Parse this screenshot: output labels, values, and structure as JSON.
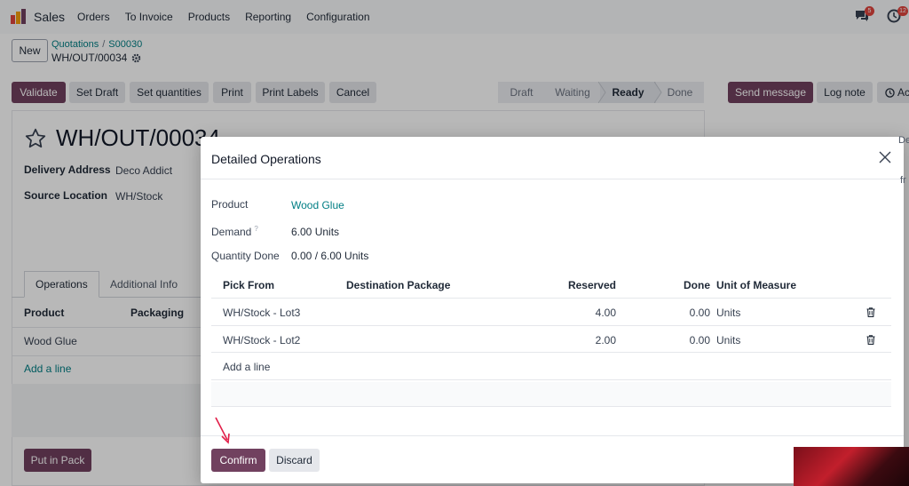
{
  "navbar": {
    "app_name": "Sales",
    "menu": [
      "Orders",
      "To Invoice",
      "Products",
      "Reporting",
      "Configuration"
    ],
    "chat_badge": "5",
    "activity_badge": "12"
  },
  "control": {
    "new_label": "New",
    "breadcrumb_parent": "Quotations",
    "breadcrumb_child": "S00030",
    "record_ref": "WH/OUT/00034"
  },
  "actions": [
    "Validate",
    "Set Draft",
    "Set quantities",
    "Print",
    "Print Labels",
    "Cancel"
  ],
  "status_stages": [
    "Draft",
    "Waiting",
    "Ready",
    "Done"
  ],
  "status_active": "Ready",
  "chatter": {
    "send_message": "Send message",
    "log_note": "Log note",
    "activities_fragment": "Ac"
  },
  "form": {
    "title": "WH/OUT/00034",
    "delivery_address_label": "Delivery Address",
    "delivery_address_value": "Deco Addict",
    "source_location_label": "Source Location",
    "source_location_value": "WH/Stock",
    "tabs": [
      "Operations",
      "Additional Info"
    ],
    "table_headers": [
      "Product",
      "Packaging"
    ],
    "row_product": "Wood Glue",
    "add_line": "Add a line",
    "put_in_pack": "Put in Pack"
  },
  "dialog": {
    "title": "Detailed Operations",
    "product_label": "Product",
    "product_value": "Wood Glue",
    "demand_label": "Demand",
    "demand_help": "?",
    "demand_value": "6.00 Units",
    "qty_done_label": "Quantity Done",
    "qty_done_value": "0.00 / 6.00 Units",
    "columns": [
      "Pick From",
      "Destination Package",
      "Reserved",
      "Done",
      "Unit of Measure"
    ],
    "rows": [
      {
        "pick_from": "WH/Stock - Lot3",
        "reserved": "4.00",
        "done": "0.00",
        "uom": "Units"
      },
      {
        "pick_from": "WH/Stock - Lot2",
        "reserved": "2.00",
        "done": "0.00",
        "uom": "Units"
      }
    ],
    "add_line": "Add a line",
    "confirm": "Confirm",
    "discard": "Discard"
  },
  "colors": {
    "primary": "#71415f",
    "link": "#017e84",
    "badge": "#e0443d",
    "annotation_arrow": "#e11d48"
  }
}
